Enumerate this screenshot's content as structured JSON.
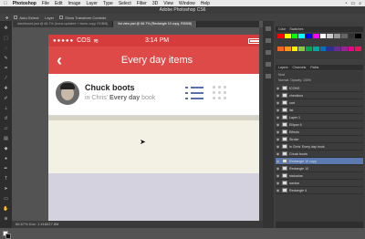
{
  "menubar": {
    "apple": "",
    "app": "Photoshop",
    "items": [
      "File",
      "Edit",
      "Image",
      "Layer",
      "Type",
      "Select",
      "Filter",
      "3D",
      "View",
      "Window",
      "Help"
    ]
  },
  "window": {
    "title": "Adobe Photoshop CS6"
  },
  "options": {
    "auto_select": "Auto-Select:",
    "group": "Layer",
    "transform": "Show Transform Controls"
  },
  "doc_tabs": [
    {
      "label": "dashboard.psd @ 66.7% (Icons updated + faces copy, RGB/8)",
      "active": false
    },
    {
      "label": "list view.psd @ 66.7% (Rectangle 10 copy, RGB/8)",
      "active": true
    }
  ],
  "phone": {
    "status": {
      "carrier": "COS",
      "signal": "●●●●●",
      "wifi": "≋",
      "time": "3:14 PM",
      "battery_pct": 90
    },
    "nav": {
      "back_icon": "‹",
      "title": "Every day items"
    },
    "item": {
      "name": "Chuck boots",
      "sub_prefix": "in Chris'",
      "sub_bold": "Every day",
      "sub_suffix": "book"
    }
  },
  "statusbar": {
    "text": "66.67%   Doc: 1.41M/27.8M"
  },
  "panels": {
    "top_tabs": [
      "Color",
      "Swatches"
    ],
    "swatch_colors": [
      "#ff0000",
      "#ffff00",
      "#00ff00",
      "#00ffff",
      "#0000ff",
      "#ff00ff",
      "#ffffff",
      "#cccccc",
      "#999999",
      "#666666",
      "#333333",
      "#000000",
      "#f26522",
      "#f7941d",
      "#fff200",
      "#8dc63f",
      "#00a651",
      "#00a99d",
      "#0072bc",
      "#2e3192",
      "#662d91",
      "#92278f",
      "#ec008c",
      "#ed145b"
    ],
    "layer_tabs": [
      "Layers",
      "Channels",
      "Paths"
    ],
    "layer_opts": {
      "kind": "Kind",
      "blend": "Normal",
      "opacity": "Opacity: 100%",
      "lock": "Lock:",
      "fill": "Fill: 100%"
    },
    "layers": [
      {
        "name": "ICONS",
        "selected": false
      },
      {
        "name": "checkbox",
        "selected": false
      },
      {
        "name": "cart",
        "selected": false
      },
      {
        "name": "list",
        "selected": false
      },
      {
        "name": "Layer 1",
        "selected": false
      },
      {
        "name": "Ellipse 6",
        "selected": false
      },
      {
        "name": "Effects",
        "selected": false
      },
      {
        "name": "Stroke",
        "selected": false
      },
      {
        "name": "in Chris' Every day book",
        "selected": false
      },
      {
        "name": "Chuck boots",
        "selected": false
      },
      {
        "name": "Rectangle 10 copy",
        "selected": true
      },
      {
        "name": "Rectangle 10",
        "selected": false
      },
      {
        "name": "statusbar",
        "selected": false
      },
      {
        "name": "navbar",
        "selected": false
      },
      {
        "name": "Rectangle 4",
        "selected": false
      }
    ]
  }
}
